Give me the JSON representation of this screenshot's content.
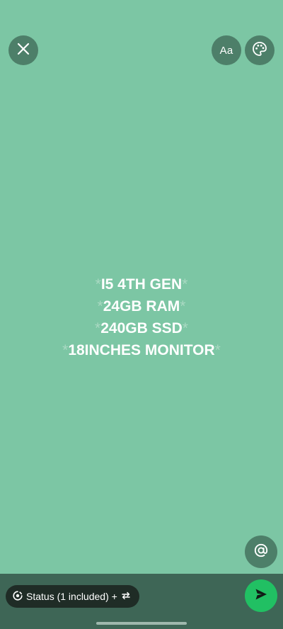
{
  "top_bar": {
    "close_icon": "close-icon",
    "font_label": "Aa",
    "palette_icon": "palette-icon"
  },
  "status": {
    "background_color": "#7cc6a4",
    "lines": [
      {
        "prefix": "*",
        "text": "I5 4TH GEN",
        "suffix": "*"
      },
      {
        "prefix": "*",
        "text": "24GB RAM",
        "suffix": "*"
      },
      {
        "prefix": "*",
        "text": "240GB SSD",
        "suffix": "*"
      },
      {
        "prefix": "*",
        "text": "18INCHES MONITOR",
        "suffix": "*"
      }
    ]
  },
  "mention_button": {
    "icon": "at-icon"
  },
  "bottom_bar": {
    "audience_label": "Status (1 included) +",
    "audience_icon": "status-icon",
    "repost_icon": "repost-icon",
    "send_icon": "send-icon",
    "send_color": "#21c063"
  }
}
